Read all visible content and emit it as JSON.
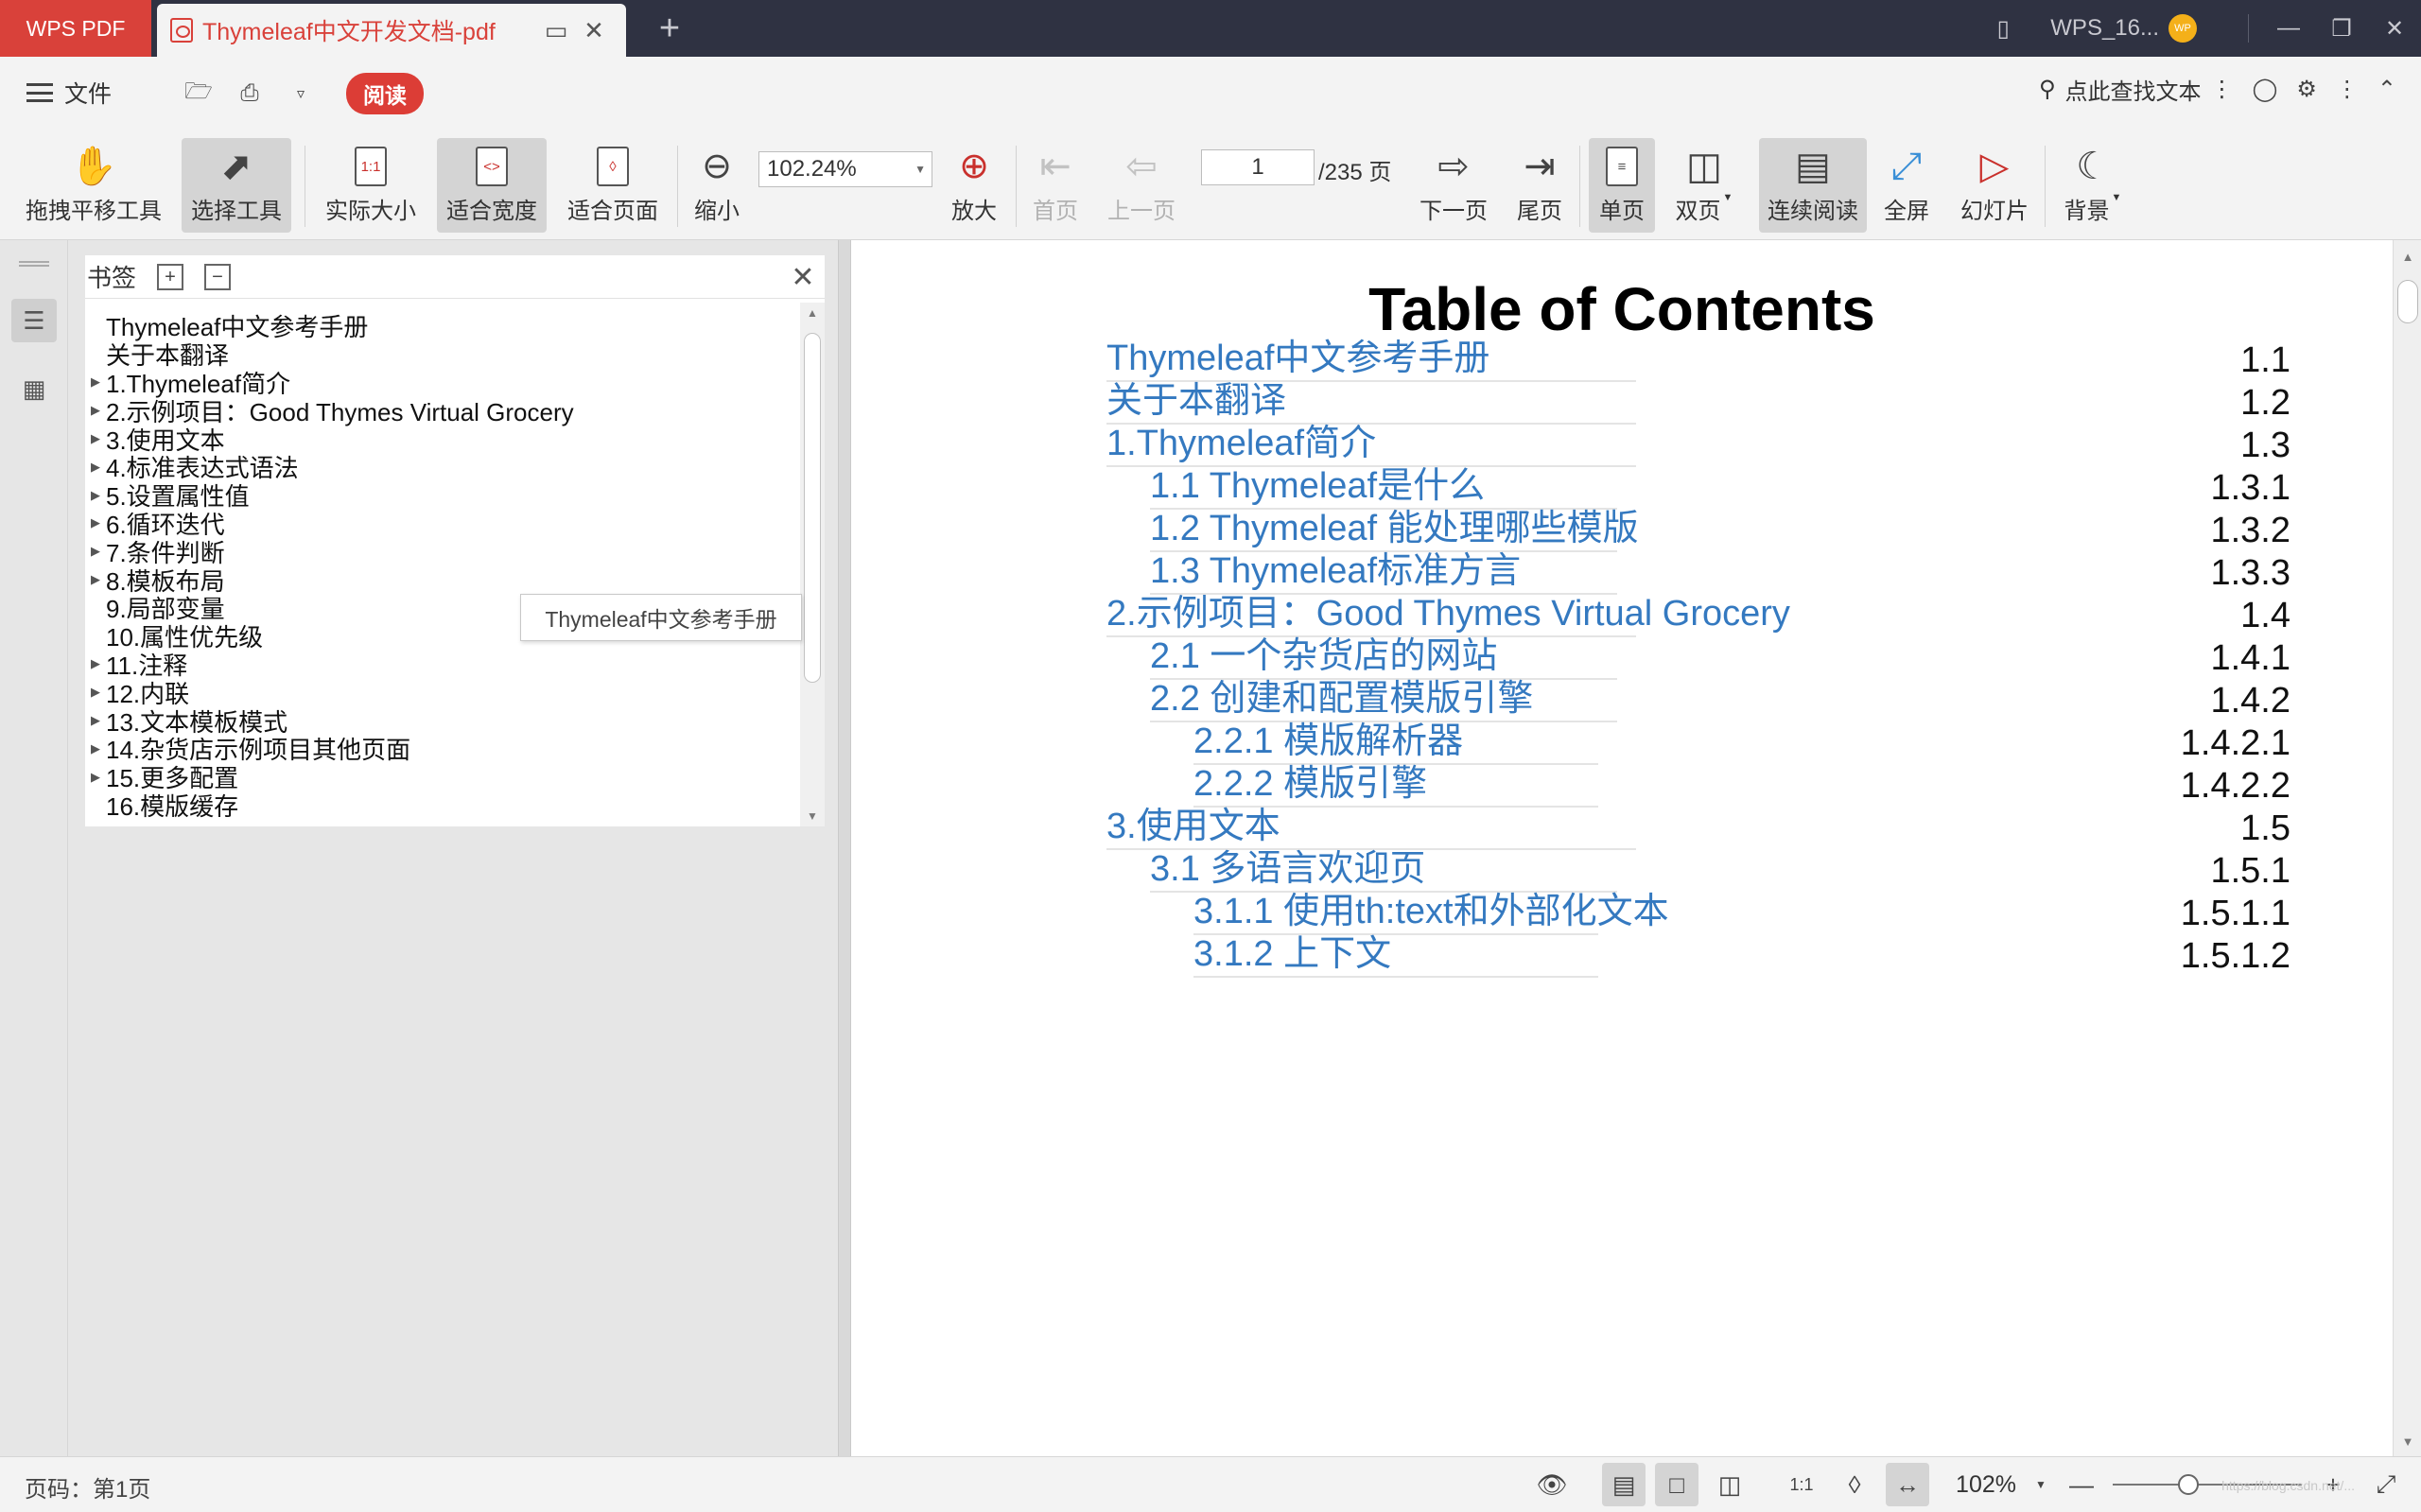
{
  "tabbar": {
    "app_name": "WPS PDF",
    "doc_tab_title": "Thymeleaf中文开发文档-pdf",
    "account_name": "WPS_16...",
    "avatar_text": "WP"
  },
  "menubar": {
    "file_label": "文件",
    "read_label": "阅读",
    "find_text_label": "点此查找文本"
  },
  "ribbon": {
    "hand_tool": "拖拽平移工具",
    "select_tool": "选择工具",
    "actual_size": "实际大小",
    "fit_width": "适合宽度",
    "fit_page": "适合页面",
    "zoom_out": "缩小",
    "zoom_value": "102.24%",
    "zoom_in": "放大",
    "first_page": "首页",
    "prev_page": "上一页",
    "current_page": "1",
    "total_pages": "/235 页",
    "next_page": "下一页",
    "last_page": "尾页",
    "single_page": "单页",
    "double_page": "双页",
    "continuous": "连续阅读",
    "fullscreen": "全屏",
    "slideshow": "幻灯片",
    "background": "背景"
  },
  "bookmarks": {
    "title": "书签",
    "tooltip": "Thymeleaf中文参考手册",
    "items": [
      {
        "label": "Thymeleaf中文参考手册",
        "expandable": false,
        "indent": 1
      },
      {
        "label": "关于本翻译",
        "expandable": false,
        "indent": 1
      },
      {
        "label": "1.Thymeleaf简介",
        "expandable": true,
        "indent": 1
      },
      {
        "label": "2.示例项目：Good Thymes Virtual Grocery",
        "expandable": true,
        "indent": 1
      },
      {
        "label": "3.使用文本",
        "expandable": true,
        "indent": 1
      },
      {
        "label": "4.标准表达式语法",
        "expandable": true,
        "indent": 1
      },
      {
        "label": "5.设置属性值",
        "expandable": true,
        "indent": 1
      },
      {
        "label": "6.循环迭代",
        "expandable": true,
        "indent": 1
      },
      {
        "label": "7.条件判断",
        "expandable": true,
        "indent": 1
      },
      {
        "label": "8.模板布局",
        "expandable": true,
        "indent": 1
      },
      {
        "label": "9.局部变量",
        "expandable": false,
        "indent": 1
      },
      {
        "label": "10.属性优先级",
        "expandable": false,
        "indent": 1
      },
      {
        "label": "11.注释",
        "expandable": true,
        "indent": 1
      },
      {
        "label": "12.内联",
        "expandable": true,
        "indent": 1
      },
      {
        "label": "13.文本模板模式",
        "expandable": true,
        "indent": 1
      },
      {
        "label": "14.杂货店示例项目其他页面",
        "expandable": true,
        "indent": 1
      },
      {
        "label": "15.更多配置",
        "expandable": true,
        "indent": 1
      },
      {
        "label": "16.模版缓存",
        "expandable": false,
        "indent": 1
      }
    ]
  },
  "document": {
    "title": "Table of Contents",
    "toc": [
      {
        "label": "Thymeleaf中文参考手册",
        "number": "1.1",
        "level": 0
      },
      {
        "label": "关于本翻译",
        "number": "1.2",
        "level": 0
      },
      {
        "label": "1.Thymeleaf简介",
        "number": "1.3",
        "level": 0
      },
      {
        "label": "1.1 Thymeleaf是什么",
        "number": "1.3.1",
        "level": 1
      },
      {
        "label": "1.2 Thymeleaf 能处理哪些模版",
        "number": "1.3.2",
        "level": 1
      },
      {
        "label": "1.3 Thymeleaf标准方言",
        "number": "1.3.3",
        "level": 1
      },
      {
        "label": "2.示例项目：Good Thymes Virtual Grocery",
        "number": "1.4",
        "level": 0
      },
      {
        "label": "2.1 一个杂货店的网站",
        "number": "1.4.1",
        "level": 1
      },
      {
        "label": "2.2 创建和配置模版引擎",
        "number": "1.4.2",
        "level": 1
      },
      {
        "label": "2.2.1 模版解析器",
        "number": "1.4.2.1",
        "level": 2
      },
      {
        "label": "2.2.2 模版引擎",
        "number": "1.4.2.2",
        "level": 2
      },
      {
        "label": "3.使用文本",
        "number": "1.5",
        "level": 0
      },
      {
        "label": "3.1 多语言欢迎页",
        "number": "1.5.1",
        "level": 1
      },
      {
        "label": "3.1.1 使用th:text和外部化文本",
        "number": "1.5.1.1",
        "level": 2
      },
      {
        "label": "3.1.2 上下文",
        "number": "1.5.1.2",
        "level": 2
      }
    ]
  },
  "statusbar": {
    "page_status": "页码：第1页",
    "zoom_value": "102%",
    "zoom_fraction": 0.4,
    "watermark": "https://blog.csdn.net/..."
  },
  "colors": {
    "brand_red": "#d9413a",
    "toc_link_blue": "#3479c0",
    "tabbar_bg": "#2f3242"
  }
}
